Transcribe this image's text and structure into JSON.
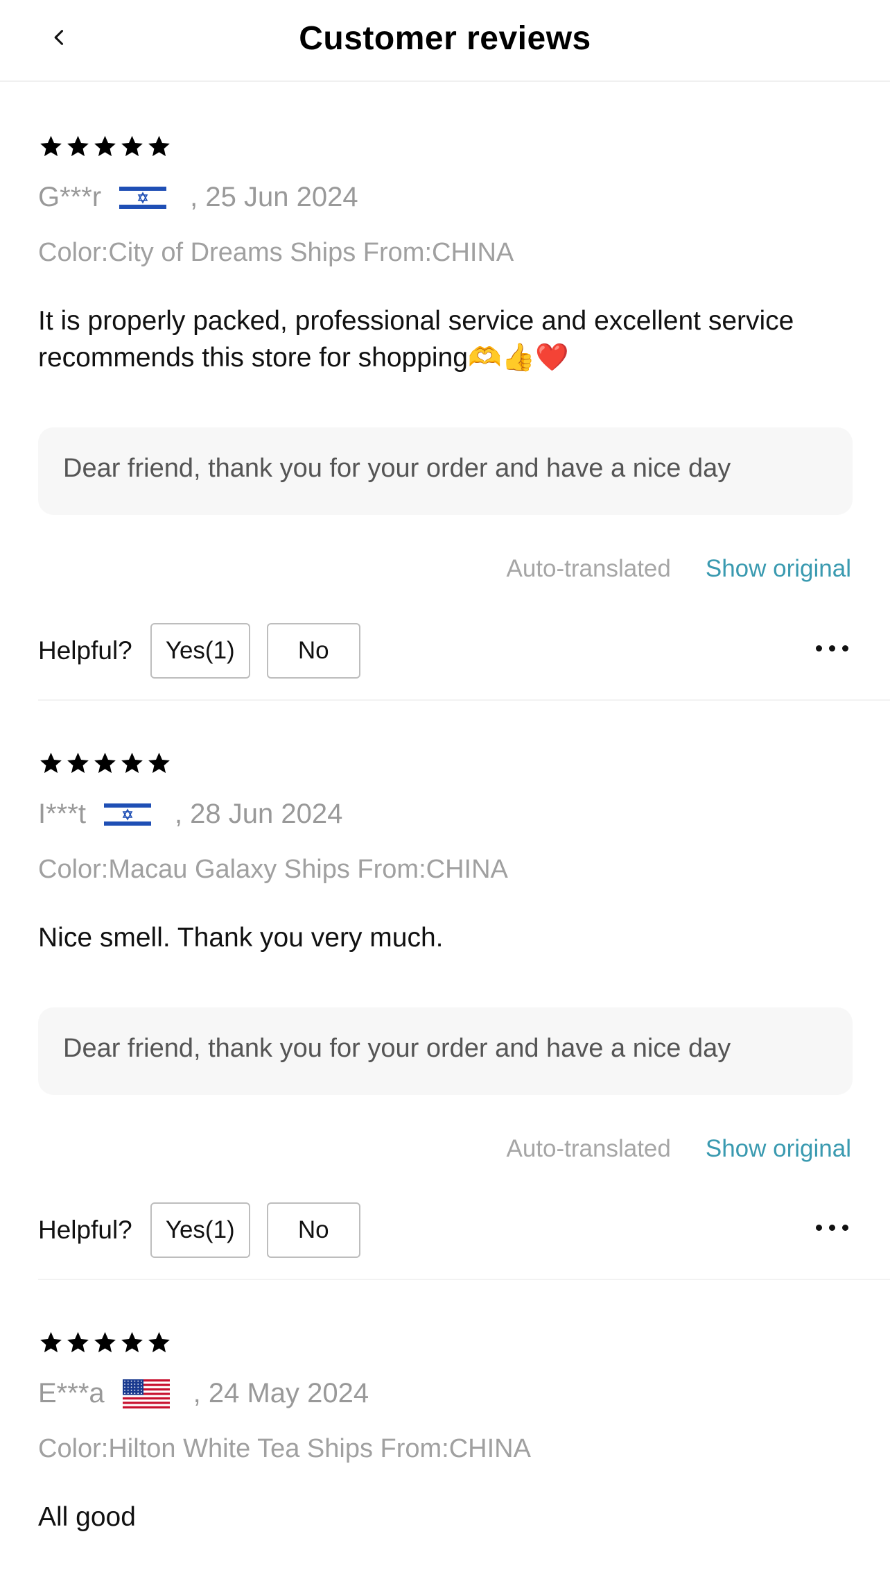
{
  "header": {
    "title": "Customer reviews",
    "back_icon": "chevron-left-icon"
  },
  "reviews": [
    {
      "rating": 5,
      "user": "G***r",
      "country_flag": "israel-flag",
      "date": ", 25 Jun 2024",
      "variant": "Color:City of Dreams Ships From:CHINA",
      "text": "It is properly packed, professional service and excellent service recommends this store for shopping🫶👍❤️",
      "reply": "Dear friend, thank you for your order and have a nice day",
      "auto_translated": "Auto-translated",
      "show_original": "Show original",
      "helpful_label": "Helpful?",
      "yes_label": "Yes(1)",
      "no_label": "No"
    },
    {
      "rating": 5,
      "user": "I***t",
      "country_flag": "israel-flag",
      "date": ", 28 Jun 2024",
      "variant": "Color:Macau Galaxy Ships From:CHINA",
      "text": "Nice smell. Thank you very much.",
      "reply": "Dear friend, thank you for your order and have a nice day",
      "auto_translated": "Auto-translated",
      "show_original": "Show original",
      "helpful_label": "Helpful?",
      "yes_label": "Yes(1)",
      "no_label": "No"
    },
    {
      "rating": 5,
      "user": "E***a",
      "country_flag": "usa-flag",
      "date": ", 24 May 2024",
      "variant": "Color:Hilton White Tea Ships From:CHINA",
      "text": "All good"
    }
  ],
  "colors": {
    "link": "#3a9ab0",
    "meta": "#999999",
    "reply_bg": "#f7f7f7"
  }
}
